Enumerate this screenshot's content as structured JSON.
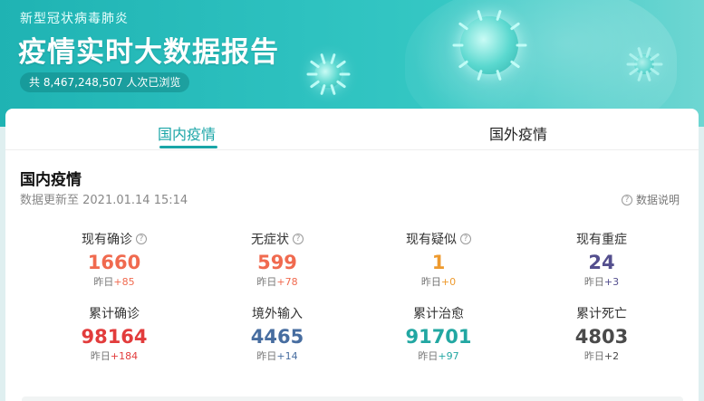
{
  "header": {
    "subtitle": "新型冠状病毒肺炎",
    "title": "疫情实时大数据报告",
    "views": "共 8,467,248,507 人次已浏览"
  },
  "tabs": [
    {
      "label": "国内疫情",
      "active": true
    },
    {
      "label": "国外疫情",
      "active": false
    }
  ],
  "section": {
    "title": "国内疫情",
    "update_time": "数据更新至 2021.01.14 15:14",
    "explain_label": "数据说明"
  },
  "stats": [
    {
      "label": "现有确诊",
      "value": "1660",
      "delta_prefix": "昨日",
      "delta": "+85",
      "color": "#f06a4f",
      "delta_color": "#f06a4f",
      "has_help": true
    },
    {
      "label": "无症状",
      "value": "599",
      "delta_prefix": "昨日",
      "delta": "+78",
      "color": "#f06a4f",
      "delta_color": "#f06a4f",
      "has_help": true
    },
    {
      "label": "现有疑似",
      "value": "1",
      "delta_prefix": "昨日",
      "delta": "+0",
      "color": "#ee9a2e",
      "delta_color": "#ee9a2e",
      "has_help": true
    },
    {
      "label": "现有重症",
      "value": "24",
      "delta_prefix": "昨日",
      "delta": "+3",
      "color": "#544f8e",
      "delta_color": "#544f8e",
      "has_help": false
    },
    {
      "label": "累计确诊",
      "value": "98164",
      "delta_prefix": "昨日",
      "delta": "+184",
      "color": "#e23c3c",
      "delta_color": "#e23c3c",
      "has_help": false
    },
    {
      "label": "境外输入",
      "value": "4465",
      "delta_prefix": "昨日",
      "delta": "+14",
      "color": "#476da0",
      "delta_color": "#476da0",
      "has_help": false
    },
    {
      "label": "累计治愈",
      "value": "91701",
      "delta_prefix": "昨日",
      "delta": "+97",
      "color": "#22a7a2",
      "delta_color": "#22a7a2",
      "has_help": false
    },
    {
      "label": "累计死亡",
      "value": "4803",
      "delta_prefix": "昨日",
      "delta": "+2",
      "color": "#4a4a4a",
      "delta_color": "#4a4a4a",
      "has_help": false
    }
  ],
  "icons": {
    "help": "?"
  }
}
